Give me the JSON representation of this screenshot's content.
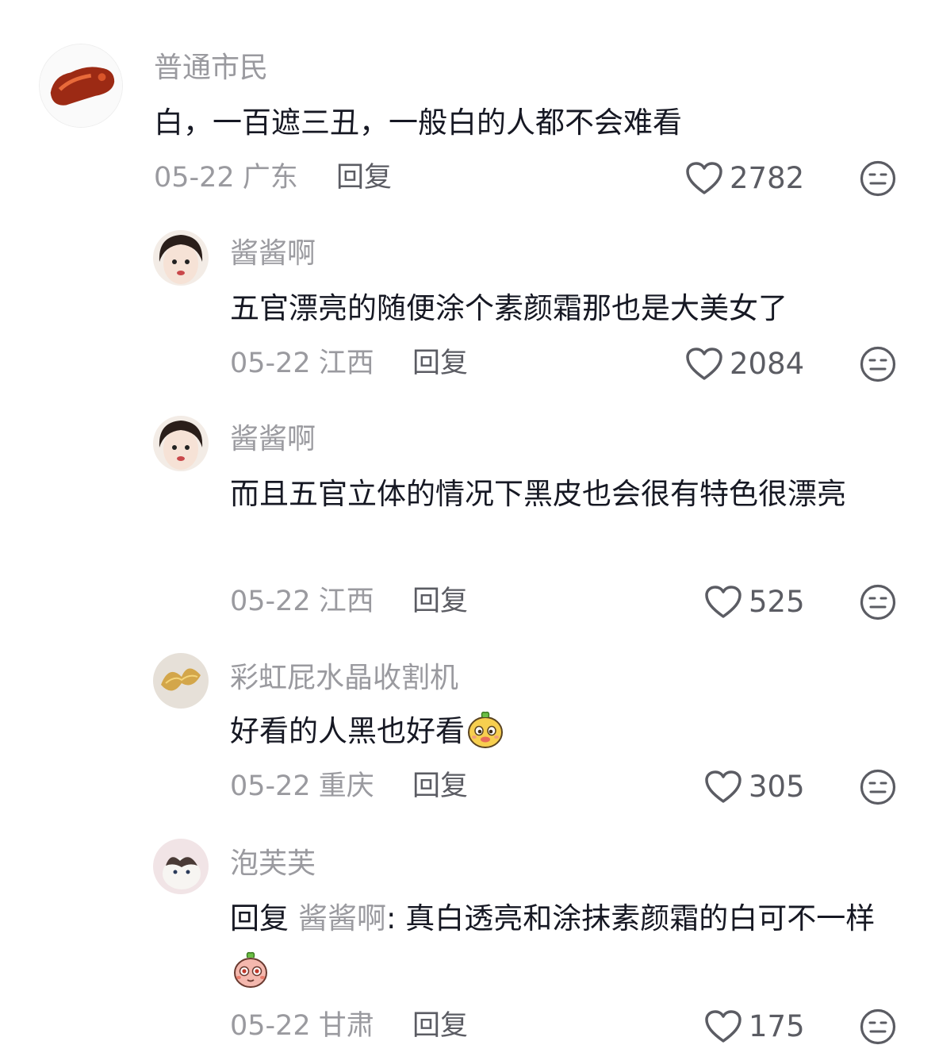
{
  "comments": [
    {
      "username": "普通市民",
      "text": "白，一百遮三丑，一般白的人都不会难看",
      "date": "05-22",
      "location": "广东",
      "reply_label": "回复",
      "likes": "2782"
    },
    {
      "username": "酱酱啊",
      "text": "五官漂亮的随便涂个素颜霜那也是大美女了",
      "date": "05-22",
      "location": "江西",
      "reply_label": "回复",
      "likes": "2084"
    },
    {
      "username": "酱酱啊",
      "text": "而且五官立体的情况下黑皮也会很有特色很漂亮",
      "date": "05-22",
      "location": "江西",
      "reply_label": "回复",
      "likes": "525"
    },
    {
      "username": "彩虹屁水晶收割机",
      "text": "好看的人黑也好看",
      "date": "05-22",
      "location": "重庆",
      "reply_label": "回复",
      "likes": "305"
    },
    {
      "username": "泡芙芙",
      "reply_prefix": "回复",
      "mention": "酱酱啊",
      "text": ": 真白透亮和涂抹素颜霜的白可不一样",
      "date": "05-22",
      "location": "甘肃",
      "reply_label": "回复",
      "likes": "175"
    }
  ]
}
